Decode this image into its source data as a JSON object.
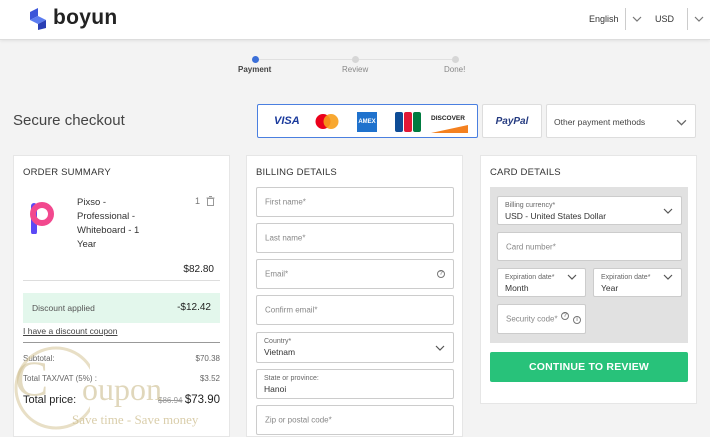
{
  "header": {
    "brand": "boyun",
    "language": "English",
    "currency": "USD"
  },
  "steps": [
    {
      "label": "Payment",
      "active": true
    },
    {
      "label": "Review",
      "active": false
    },
    {
      "label": "Done!",
      "active": false
    }
  ],
  "checkout_title": "Secure checkout",
  "payment_methods": {
    "cards": [
      "VISA",
      "Mastercard",
      "American Express",
      "JCB",
      "DISCOVER"
    ],
    "visa": "VISA",
    "amex": "AMEX",
    "discover": "DISCOVER",
    "paypal": "PayPal",
    "other": "Other payment methods"
  },
  "order_summary": {
    "title": "ORDER SUMMARY",
    "product_name": [
      "Pixso -",
      "Professional -",
      "Whiteboard - 1",
      "Year"
    ],
    "quantity": "1",
    "price": "$82.80",
    "discount_label": "Discount applied",
    "discount_value": "-$12.42",
    "coupon_link": "I have a discount coupon",
    "subtotal_label": "Subtotal:",
    "subtotal_value": "$70.38",
    "tax_label": "Total TAX/VAT (5%) :",
    "tax_value": "$3.52",
    "total_label": "Total price:",
    "total_old": "$86.94",
    "total_value": "$73.90"
  },
  "billing": {
    "title": "BILLING DETAILS",
    "first_name": "First name*",
    "last_name": "Last name*",
    "email": "Email*",
    "confirm_email": "Confirm email*",
    "country_label": "Country*",
    "country_value": "Vietnam",
    "state_label": "State or province:",
    "state_value": "Hanoi",
    "zip": "Zip or postal code*"
  },
  "card": {
    "title": "CARD DETAILS",
    "currency_label": "Billing currency*",
    "currency_value": "USD - United States Dollar",
    "card_number": "Card number*",
    "exp_month_label": "Expiration date*",
    "exp_month_value": "Month",
    "exp_year_label": "Expiration date*",
    "exp_year_value": "Year",
    "security_code": "Security code*",
    "cta": "CONTINUE TO REVIEW"
  },
  "watermark": {
    "word": "oupon",
    "letter": "C",
    "tagline": "Save time - Save money"
  },
  "colors": {
    "accent_blue": "#3b6fd8",
    "cta_green": "#28c27a",
    "discount_bg": "#e3f7ec"
  }
}
